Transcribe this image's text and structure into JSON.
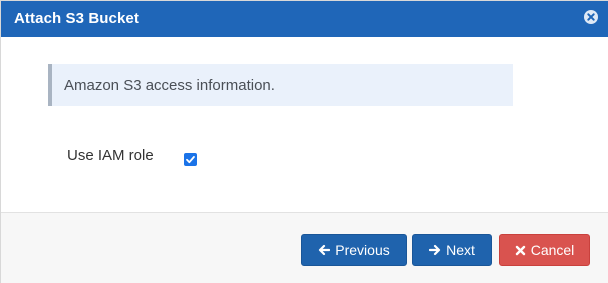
{
  "dialog": {
    "title": "Attach S3 Bucket",
    "colors": {
      "titlebar": "#1f66b8",
      "primary_button": "#1f63ad",
      "cancel_button": "#d9534f",
      "info_bg": "#eaf1fb"
    }
  },
  "info": {
    "text": "Amazon S3 access information."
  },
  "iam": {
    "label": "Use IAM role",
    "checked": true
  },
  "footer": {
    "previous_label": "Previous",
    "next_label": "Next",
    "cancel_label": "Cancel"
  },
  "icons": {
    "close": "close-circle-icon",
    "previous": "arrow-left-icon",
    "next": "arrow-right-icon",
    "cancel": "x-icon"
  }
}
